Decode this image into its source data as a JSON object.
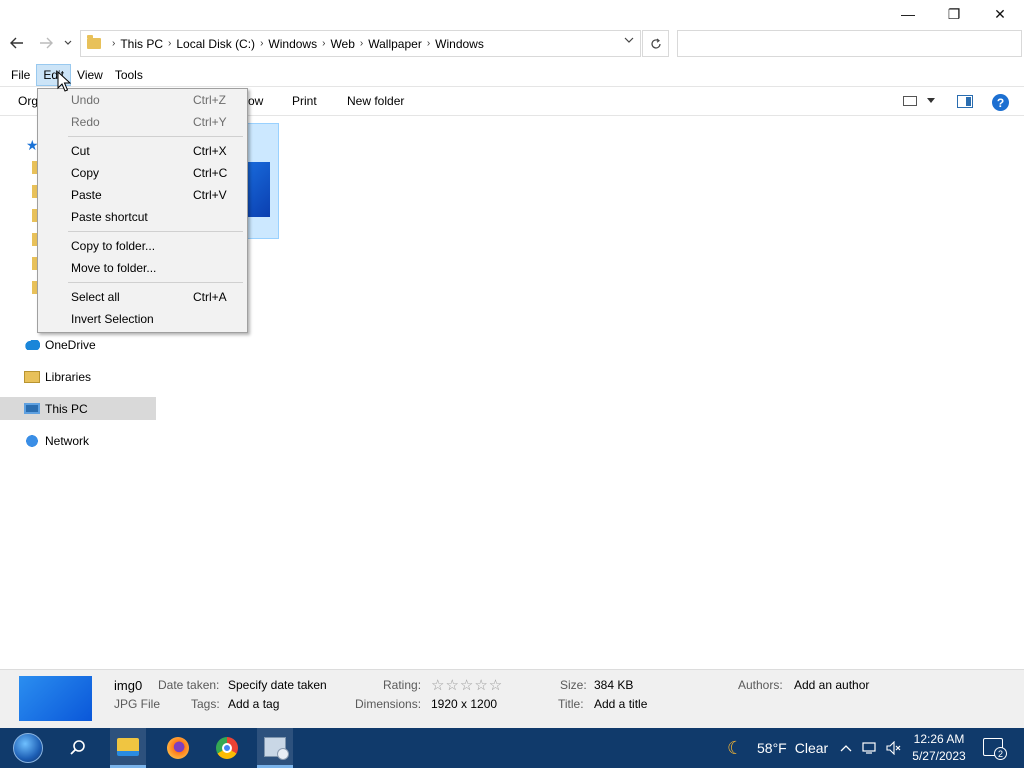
{
  "window": {
    "minimize_glyph": "—",
    "restore_glyph": "❐",
    "close_glyph": "✕"
  },
  "address_bar": {
    "breadcrumbs": [
      "This PC",
      "Local Disk (C:)",
      "Windows",
      "Web",
      "Wallpaper",
      "Windows"
    ],
    "search_placeholder": ""
  },
  "menubar": {
    "file": "File",
    "edit": "Edit",
    "view": "View",
    "tools": "Tools"
  },
  "commandbar": {
    "organize": "Org",
    "slideshow": "ow",
    "print": "Print",
    "new_folder": "New folder",
    "help": "?"
  },
  "navpane": {
    "items": [
      {
        "label": "OneDrive",
        "icon": "onedrive-icon"
      },
      {
        "label": "Libraries",
        "icon": "libraries-icon"
      },
      {
        "label": "This PC",
        "icon": "this-pc-icon",
        "selected": true
      },
      {
        "label": "Network",
        "icon": "network-icon"
      }
    ]
  },
  "edit_menu": {
    "items": [
      {
        "label": "Undo",
        "shortcut": "Ctrl+Z",
        "disabled": true
      },
      {
        "label": "Redo",
        "shortcut": "Ctrl+Y",
        "disabled": true
      },
      {
        "label": "Cut",
        "shortcut": "Ctrl+X"
      },
      {
        "label": "Copy",
        "shortcut": "Ctrl+C"
      },
      {
        "label": "Paste",
        "shortcut": "Ctrl+V"
      },
      {
        "label": "Paste shortcut",
        "shortcut": ""
      },
      {
        "label": "Copy to folder...",
        "shortcut": ""
      },
      {
        "label": "Move to folder...",
        "shortcut": ""
      },
      {
        "label": "Select all",
        "shortcut": "Ctrl+A"
      },
      {
        "label": "Invert Selection",
        "shortcut": ""
      }
    ]
  },
  "details": {
    "name": "img0",
    "type": "JPG File",
    "date_taken_label": "Date taken:",
    "date_taken_value": "Specify date taken",
    "tags_label": "Tags:",
    "tags_value": "Add a tag",
    "rating_label": "Rating:",
    "rating_stars": "☆☆☆☆☆",
    "rating_value": 0,
    "dimensions_label": "Dimensions:",
    "dimensions_value": "1920 x 1200",
    "size_label": "Size:",
    "size_value": "384 KB",
    "title_label": "Title:",
    "title_value": "Add a title",
    "authors_label": "Authors:",
    "authors_value": "Add an author"
  },
  "taskbar": {
    "apps": [
      "file-explorer",
      "firefox",
      "chrome",
      "disk-management"
    ],
    "weather_temp": "58°F",
    "weather_text": "Clear",
    "time": "12:26 AM",
    "date": "5/27/2023",
    "notification_count": "2"
  }
}
